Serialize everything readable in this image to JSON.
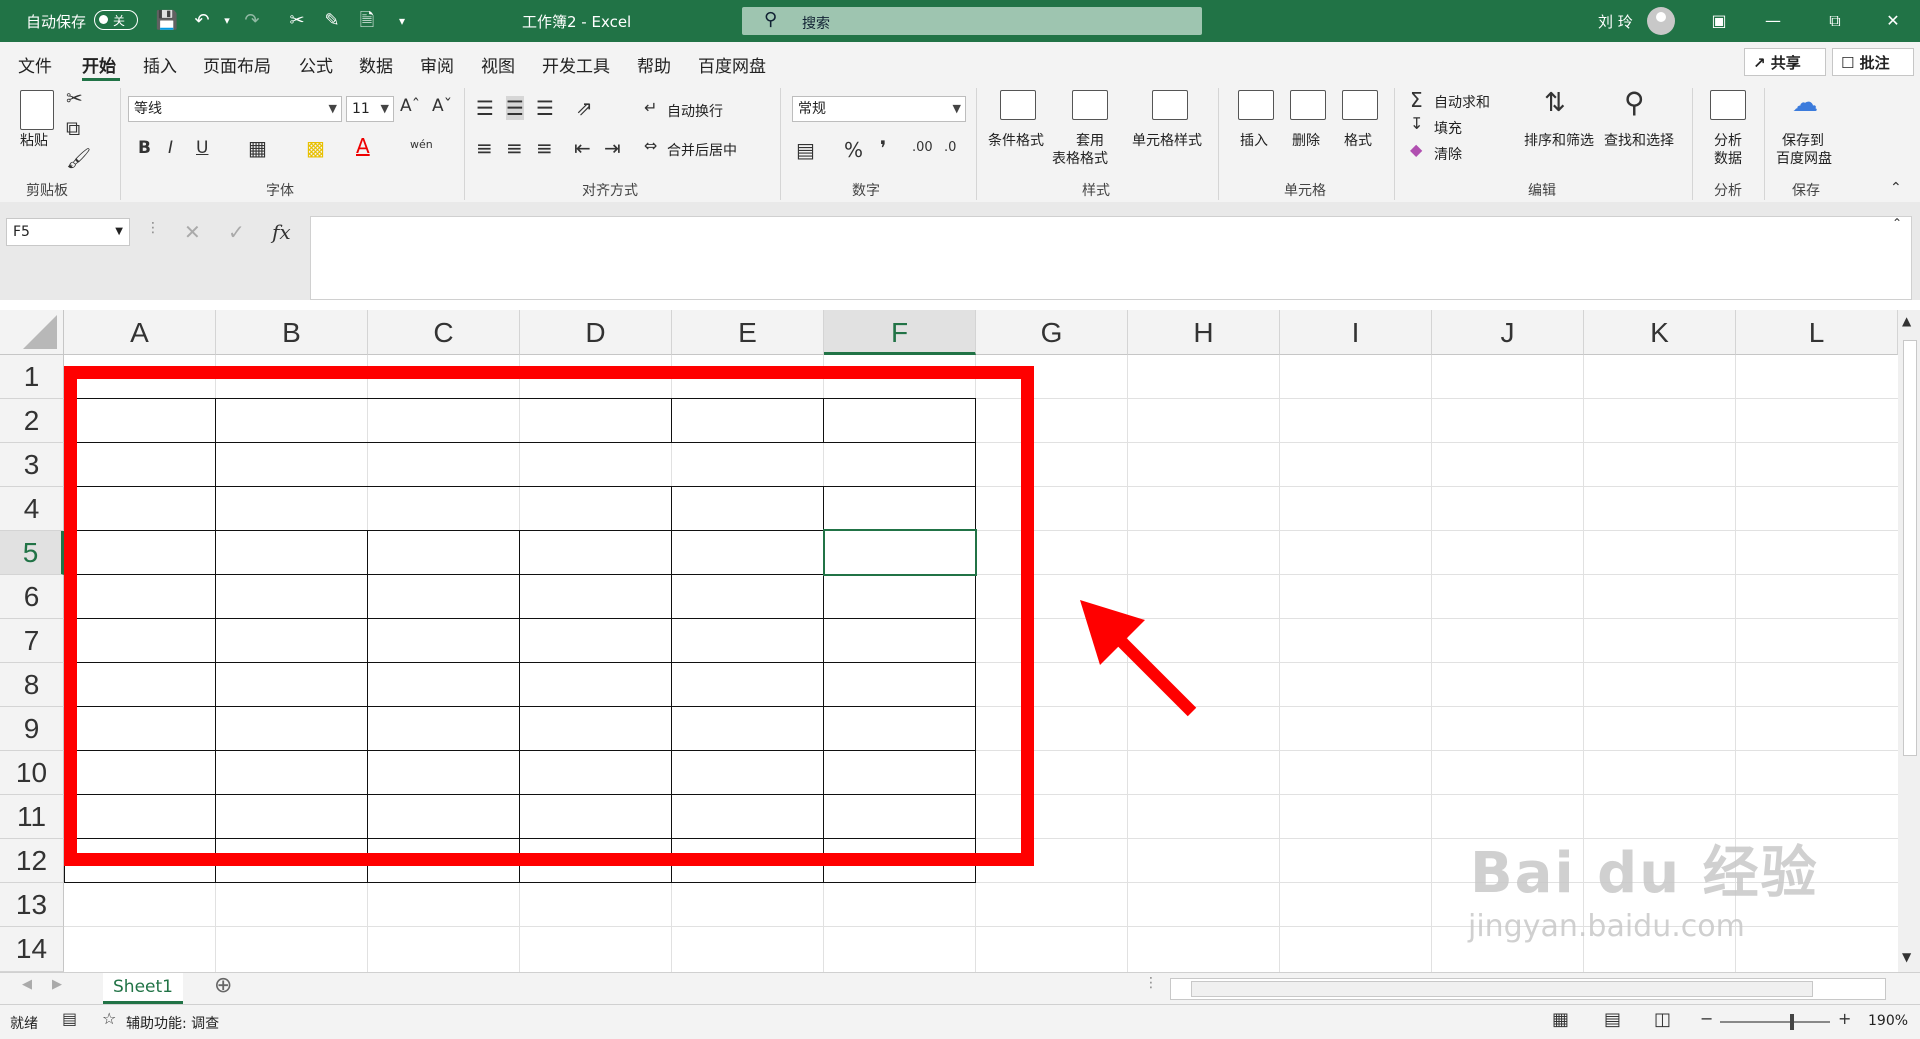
{
  "titlebar": {
    "autosave_label": "自动保存",
    "autosave_state": "关",
    "doc_title": "工作簿2  -  Excel",
    "search_placeholder": "搜索",
    "user_name": "刘 玲"
  },
  "tabs": [
    "文件",
    "开始",
    "插入",
    "页面布局",
    "公式",
    "数据",
    "审阅",
    "视图",
    "开发工具",
    "帮助",
    "百度网盘"
  ],
  "top_buttons": {
    "share": "共享",
    "comments": "批注"
  },
  "ribbon": {
    "clipboard": {
      "paste": "粘贴",
      "label": "剪贴板"
    },
    "font": {
      "name": "等线",
      "size": "11",
      "label": "字体",
      "bold": "B",
      "italic": "I",
      "underline": "U",
      "wen": "wén"
    },
    "align": {
      "wrap": "自动换行",
      "merge": "合并后居中",
      "label": "对齐方式"
    },
    "number": {
      "format": "常规",
      "label": "数字",
      "percent": "%"
    },
    "styles": {
      "cond": "条件格式",
      "table1": "套用",
      "table2": "表格格式",
      "cell": "单元格样式",
      "label": "样式"
    },
    "cells": {
      "insert": "插入",
      "delete": "删除",
      "format": "格式",
      "label": "单元格"
    },
    "editing": {
      "autosum": "自动求和",
      "fill": "填充",
      "clear": "清除",
      "sort": "排序和筛选",
      "find": "查找和选择",
      "label": "编辑"
    },
    "analyze": {
      "btn1": "分析",
      "btn2": "数据",
      "label": "分析"
    },
    "save": {
      "btn1": "保存到",
      "btn2": "百度网盘",
      "label": "保存"
    }
  },
  "formula_bar": {
    "name_box": "F5",
    "fx": "fx"
  },
  "columns": [
    "A",
    "B",
    "C",
    "D",
    "E",
    "F",
    "G",
    "H",
    "I",
    "J",
    "K",
    "L"
  ],
  "rows": [
    "1",
    "2",
    "3",
    "4",
    "5",
    "6",
    "7",
    "8",
    "9",
    "10",
    "11",
    "12",
    "13",
    "14"
  ],
  "selected_column": "F",
  "selected_row": "5",
  "sheet_tab": "Sheet1",
  "status": {
    "ready": "就绪",
    "accessibility": "辅助功能: 调查",
    "zoom": "190%"
  },
  "watermark": {
    "logo": "Bai du 经验",
    "url": "jingyan.baidu.com"
  },
  "colors": {
    "excel_green": "#217346",
    "highlight_red": "#ff0000"
  }
}
